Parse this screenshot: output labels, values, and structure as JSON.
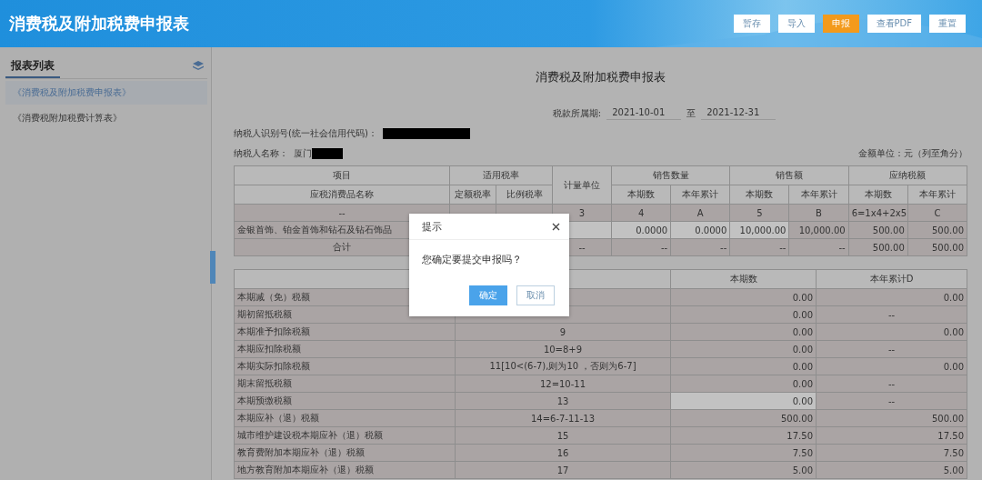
{
  "header": {
    "title": "消费税及附加税费申报表",
    "buttons": [
      {
        "label": "暂存",
        "kind": "plain"
      },
      {
        "label": "导入",
        "kind": "plain"
      },
      {
        "label": "申报",
        "kind": "primary"
      },
      {
        "label": "查看PDF",
        "kind": "plain"
      },
      {
        "label": "重置",
        "kind": "plain"
      }
    ]
  },
  "sidebar": {
    "title": "报表列表",
    "items": [
      {
        "label": "《消费税及附加税费申报表》",
        "selected": true
      },
      {
        "label": "《消费税附加税费计算表》",
        "selected": false
      }
    ]
  },
  "form": {
    "title": "消费税及附加税费申报表",
    "period": {
      "label": "税款所属期:",
      "start": "2021-10-01",
      "separator": "至",
      "end": "2021-12-31"
    },
    "taxpayer_id": {
      "label": "纳税人识别号(统一社会信用代码)："
    },
    "taxpayer_name": {
      "label": "纳税人名称：",
      "value": "厦门"
    },
    "unit_note": "金额单位：元（列至角分）",
    "table1": {
      "groups": [
        {
          "label": "项目",
          "columns": [
            "应税消费品名称"
          ]
        },
        {
          "label": "适用税率",
          "columns": [
            "定额税率",
            "比例税率"
          ]
        },
        {
          "label": "计量单位"
        },
        {
          "label": "销售数量",
          "columns": [
            "本期数",
            "本年累计"
          ]
        },
        {
          "label": "销售额",
          "columns": [
            "本期数",
            "本年累计"
          ]
        },
        {
          "label": "应纳税额",
          "columns": [
            "本期数",
            "本年累计"
          ]
        }
      ],
      "rows": [
        [
          {
            "text": "--",
            "shaded": true
          },
          {
            "shaded": true
          },
          {
            "shaded": true
          },
          {
            "text": "3",
            "shaded": true
          },
          {
            "text": "4",
            "shaded": true
          },
          {
            "text": "A",
            "shaded": true
          },
          {
            "text": "5",
            "shaded": true
          },
          {
            "text": "B",
            "shaded": true
          },
          {
            "text": "6=1x4+2x5",
            "shaded": true
          },
          {
            "text": "C",
            "shaded": true
          }
        ],
        [
          {
            "text": "金银首饰、铂金首饰和钻石及钻石饰品",
            "shaded": true
          },
          null,
          null,
          {
            "shaded": false
          },
          {
            "text": "0.0000",
            "shaded": false
          },
          {
            "text": "0.0000",
            "shaded": false
          },
          {
            "text": "10,000.00",
            "shaded": false
          },
          {
            "text": "10,000.00",
            "shaded": true
          },
          {
            "text": "500.00",
            "shaded": true
          },
          {
            "text": "500.00",
            "shaded": true
          }
        ],
        [
          {
            "text": "合计",
            "shaded": true
          },
          null,
          null,
          {
            "text": "--",
            "shaded": true
          },
          {
            "text": "--",
            "shaded": true
          },
          {
            "text": "--",
            "shaded": true
          },
          {
            "text": "--",
            "shaded": true
          },
          {
            "text": "--",
            "shaded": true
          },
          {
            "text": "500.00",
            "shaded": true
          },
          {
            "text": "500.00",
            "shaded": true
          }
        ]
      ]
    },
    "table2": {
      "columns": [
        "本期数",
        "本年累计D"
      ],
      "rows": [
        {
          "label": "本期减（免）税额",
          "current": "0.00",
          "current_shaded": true,
          "year": "0.00"
        },
        {
          "label": "期初留抵税额",
          "current": "0.00",
          "current_shaded": true,
          "year": "--"
        },
        {
          "label": "本期准予扣除税额",
          "formula": "9",
          "current": "0.00",
          "current_shaded": true,
          "year": "0.00"
        },
        {
          "label": "本期应扣除税额",
          "formula": "10=8+9",
          "current": "0.00",
          "current_shaded": true,
          "year": "--"
        },
        {
          "label": "本期实际扣除税额",
          "formula": "11[10<(6-7),则为10 ，否则为6-7]",
          "current": "0.00",
          "current_shaded": true,
          "year": "0.00"
        },
        {
          "label": "期末留抵税额",
          "formula": "12=10-11",
          "current": "0.00",
          "current_shaded": true,
          "year": "--"
        },
        {
          "label": "本期预缴税额",
          "formula": "13",
          "current": "0.00",
          "current_shaded": false,
          "year": "--"
        },
        {
          "label": "本期应补（退）税额",
          "formula": "14=6-7-11-13",
          "current": "500.00",
          "current_shaded": true,
          "year": "500.00"
        },
        {
          "label": "城市维护建设税本期应补（退）税额",
          "formula": "15",
          "current": "17.50",
          "current_shaded": true,
          "year": "17.50"
        },
        {
          "label": "教育费附加本期应补（退）税额",
          "formula": "16",
          "current": "7.50",
          "current_shaded": true,
          "year": "7.50"
        },
        {
          "label": "地方教育附加本期应补（退）税额",
          "formula": "17",
          "current": "5.00",
          "current_shaded": true,
          "year": "5.00"
        }
      ]
    }
  },
  "dialog": {
    "title": "提示",
    "message": "您确定要提交申报吗？",
    "buttons": [
      {
        "label": "确定",
        "kind": "primary"
      },
      {
        "label": "取消",
        "kind": "plain"
      }
    ]
  }
}
